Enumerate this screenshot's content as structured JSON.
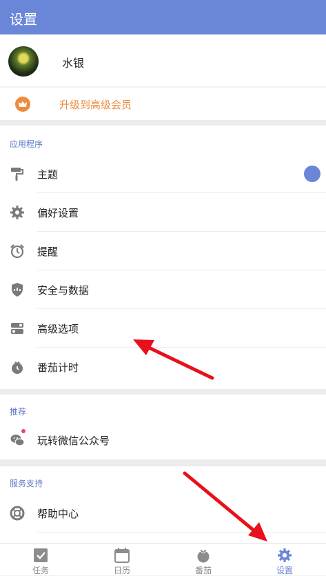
{
  "header": {
    "title": "设置"
  },
  "profile": {
    "username": "水银"
  },
  "vip": {
    "label": "升级到高级会员"
  },
  "sections": {
    "apps": {
      "title": "应用程序",
      "items": [
        "主题",
        "偏好设置",
        "提醒",
        "安全与数据",
        "高级选项",
        "番茄计时"
      ]
    },
    "recommend": {
      "title": "推荐",
      "items": [
        "玩转微信公众号"
      ]
    },
    "support": {
      "title": "服务支持",
      "items": [
        "帮助中心"
      ]
    }
  },
  "tabbar": {
    "tabs": [
      "任务",
      "日历",
      "番茄",
      "设置"
    ],
    "active_index": 3
  },
  "colors": {
    "accent": "#6a86d9",
    "vip": "#ee8a3a",
    "annotation_arrow": "#e8101a"
  }
}
